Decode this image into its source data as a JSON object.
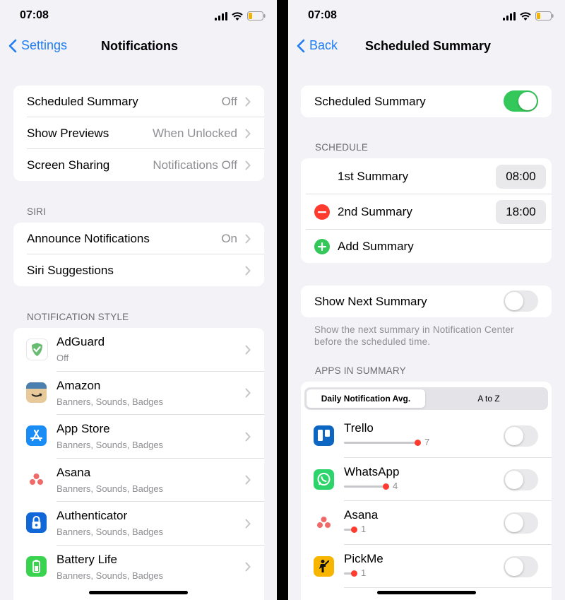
{
  "left": {
    "time": "07:08",
    "back_label": "Settings",
    "title": "Notifications",
    "top_rows": [
      {
        "label": "Scheduled Summary",
        "value": "Off"
      },
      {
        "label": "Show Previews",
        "value": "When Unlocked"
      },
      {
        "label": "Screen Sharing",
        "value": "Notifications Off"
      }
    ],
    "siri_header": "SIRI",
    "siri_rows": [
      {
        "label": "Announce Notifications",
        "value": "On"
      },
      {
        "label": "Siri Suggestions",
        "value": ""
      }
    ],
    "style_header": "NOTIFICATION STYLE",
    "apps": [
      {
        "name": "AdGuard",
        "sub": "Off"
      },
      {
        "name": "Amazon",
        "sub": "Banners, Sounds, Badges"
      },
      {
        "name": "App Store",
        "sub": "Banners, Sounds, Badges"
      },
      {
        "name": "Asana",
        "sub": "Banners, Sounds, Badges"
      },
      {
        "name": "Authenticator",
        "sub": "Banners, Sounds, Badges"
      },
      {
        "name": "Battery Life",
        "sub": "Banners, Sounds, Badges"
      }
    ]
  },
  "right": {
    "time": "07:08",
    "back_label": "Back",
    "title": "Scheduled Summary",
    "main_toggle": {
      "label": "Scheduled Summary",
      "on": true
    },
    "schedule_header": "SCHEDULE",
    "schedule": [
      {
        "label": "1st Summary",
        "time": "08:00"
      },
      {
        "label": "2nd Summary",
        "time": "18:00"
      }
    ],
    "add_label": "Add Summary",
    "next_toggle": {
      "label": "Show Next Summary",
      "on": false
    },
    "next_footer_line1": "Show the next summary in Notification Center",
    "next_footer_line2": "before the scheduled time.",
    "apps_header": "APPS IN SUMMARY",
    "segments": [
      "Daily Notification Avg.",
      "A to Z"
    ],
    "apps": [
      {
        "name": "Trello",
        "count": "7",
        "level": 1.0
      },
      {
        "name": "WhatsApp",
        "count": "4",
        "level": 0.57
      },
      {
        "name": "Asana",
        "count": "1",
        "level": 0.14
      },
      {
        "name": "PickMe",
        "count": "1",
        "level": 0.14
      }
    ]
  },
  "colors": {
    "accent": "#1f7cf4",
    "toggle_on": "#34c759",
    "remove": "#ff3b30",
    "add": "#34c759",
    "background": "#f2f2f7"
  }
}
